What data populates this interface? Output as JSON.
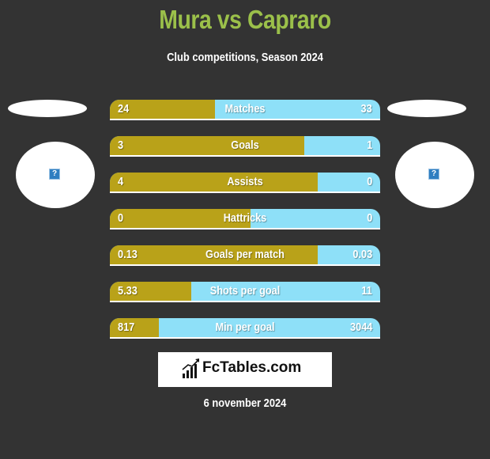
{
  "header": {
    "title": "Mura vs Capraro",
    "subtitle": "Club competitions, Season 2024"
  },
  "colors": {
    "background": "#333333",
    "title": "#9bc04a",
    "left_bar": "#b9a219",
    "right_bar": "#8ee0f8"
  },
  "players": {
    "left": {
      "name": "Mura",
      "logo_icon": "missing-image-icon"
    },
    "right": {
      "name": "Capraro",
      "logo_icon": "missing-image-icon"
    }
  },
  "stats": [
    {
      "label": "Matches",
      "left": "24",
      "right": "33",
      "left_share": 0.39
    },
    {
      "label": "Goals",
      "left": "3",
      "right": "1",
      "left_share": 0.72
    },
    {
      "label": "Assists",
      "left": "4",
      "right": "0",
      "left_share": 0.77
    },
    {
      "label": "Hattricks",
      "left": "0",
      "right": "0",
      "left_share": 0.52
    },
    {
      "label": "Goals per match",
      "left": "0.13",
      "right": "0.03",
      "left_share": 0.77
    },
    {
      "label": "Shots per goal",
      "left": "5.33",
      "right": "11",
      "left_share": 0.3
    },
    {
      "label": "Min per goal",
      "left": "817",
      "right": "3044",
      "left_share": 0.18
    }
  ],
  "brand": {
    "text": "FcTables.com",
    "icon": "bar-chart-icon"
  },
  "footer": {
    "date": "6 november 2024"
  }
}
